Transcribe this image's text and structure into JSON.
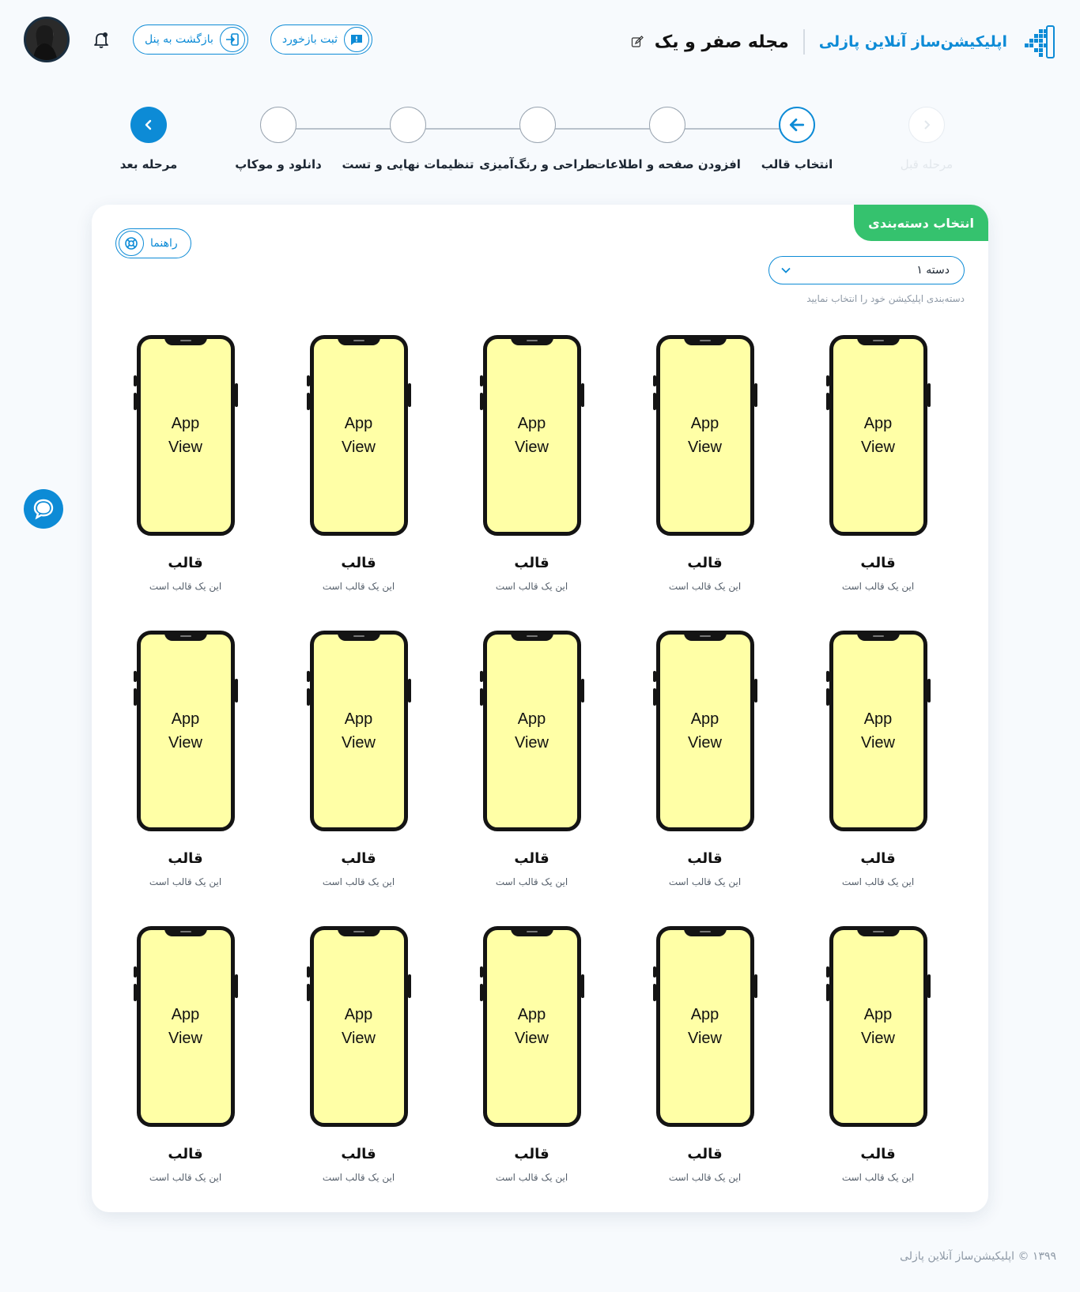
{
  "header": {
    "brand_name": "اپلیکیشن‌ساز آنلاین پازلی",
    "project_title": "مجله صفر و یک",
    "feedback_label": "ثبت بازخورد",
    "back_to_panel_label": "بازگشت به پنل"
  },
  "stepper": {
    "steps": [
      {
        "label": "مرحله قبل",
        "state": "disabled"
      },
      {
        "label": "انتخاب قالب",
        "state": "active"
      },
      {
        "label": "افزودن صفحه و اطلاعات",
        "state": "pending"
      },
      {
        "label": "طراحی و رنگ‌آمیزی",
        "state": "pending"
      },
      {
        "label": "تنظیمات نهایی و تست",
        "state": "pending"
      },
      {
        "label": "دانلود و موکاپ",
        "state": "pending"
      },
      {
        "label": "مرحله بعد",
        "state": "next"
      }
    ]
  },
  "card": {
    "tab_label": "انتخاب دسته‌بندی",
    "guide_label": "راهنما",
    "category_select": {
      "value": "دسته ۱"
    },
    "category_help": "دسته‌بندی اپلیکیشن خود را انتخاب نمایید",
    "templates": [
      {
        "screen_line1": "App",
        "screen_line2": "View",
        "title": "قالب",
        "description": "این یک قالب است"
      },
      {
        "screen_line1": "App",
        "screen_line2": "View",
        "title": "قالب",
        "description": "این یک قالب است"
      },
      {
        "screen_line1": "App",
        "screen_line2": "View",
        "title": "قالب",
        "description": "این یک قالب است"
      },
      {
        "screen_line1": "App",
        "screen_line2": "View",
        "title": "قالب",
        "description": "این یک قالب است"
      },
      {
        "screen_line1": "App",
        "screen_line2": "View",
        "title": "قالب",
        "description": "این یک قالب است"
      },
      {
        "screen_line1": "App",
        "screen_line2": "View",
        "title": "قالب",
        "description": "این یک قالب است"
      },
      {
        "screen_line1": "App",
        "screen_line2": "View",
        "title": "قالب",
        "description": "این یک قالب است"
      },
      {
        "screen_line1": "App",
        "screen_line2": "View",
        "title": "قالب",
        "description": "این یک قالب است"
      },
      {
        "screen_line1": "App",
        "screen_line2": "View",
        "title": "قالب",
        "description": "این یک قالب است"
      },
      {
        "screen_line1": "App",
        "screen_line2": "View",
        "title": "قالب",
        "description": "این یک قالب است"
      },
      {
        "screen_line1": "App",
        "screen_line2": "View",
        "title": "قالب",
        "description": "این یک قالب است"
      },
      {
        "screen_line1": "App",
        "screen_line2": "View",
        "title": "قالب",
        "description": "این یک قالب است"
      },
      {
        "screen_line1": "App",
        "screen_line2": "View",
        "title": "قالب",
        "description": "این یک قالب است"
      },
      {
        "screen_line1": "App",
        "screen_line2": "View",
        "title": "قالب",
        "description": "این یک قالب است"
      },
      {
        "screen_line1": "App",
        "screen_line2": "View",
        "title": "قالب",
        "description": "این یک قالب است"
      }
    ]
  },
  "footer": {
    "copyright": "۱۳۹۹ © اپلیکیشن‌ساز آنلاین پازلی"
  },
  "icons": {
    "brand": "puzzle-dots-logo-icon",
    "edit": "edit-pencil-icon",
    "bell": "bell-icon",
    "feedback": "feedback-message-icon",
    "back": "exit-arrow-icon",
    "guide": "lifebuoy-icon",
    "chevron": "chevron-down-icon",
    "chat": "chat-bubble-icon"
  },
  "colors": {
    "primary": "#0d8bd6",
    "tab_green": "#35c26e",
    "phone_screen": "#ffffa6",
    "background": "#f7fafd"
  }
}
